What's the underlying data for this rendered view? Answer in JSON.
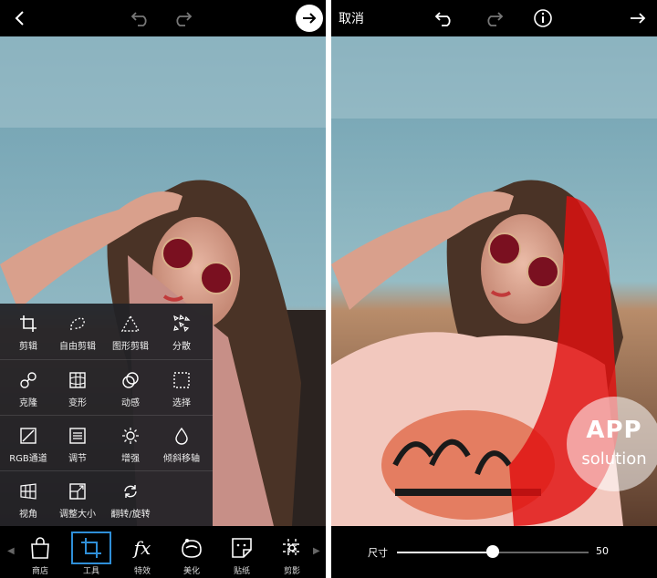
{
  "left": {
    "tools": [
      [
        {
          "label": "剪辑",
          "icon": "crop-icon"
        },
        {
          "label": "自由剪辑",
          "icon": "freecrop-icon"
        },
        {
          "label": "图形剪辑",
          "icon": "shapecrop-icon"
        },
        {
          "label": "分散",
          "icon": "disperse-icon"
        }
      ],
      [
        {
          "label": "克隆",
          "icon": "clone-icon"
        },
        {
          "label": "变形",
          "icon": "warp-icon"
        },
        {
          "label": "动感",
          "icon": "motion-icon"
        },
        {
          "label": "选择",
          "icon": "select-icon"
        }
      ],
      [
        {
          "label": "RGB通道",
          "icon": "rgb-icon"
        },
        {
          "label": "调节",
          "icon": "adjust-icon"
        },
        {
          "label": "增强",
          "icon": "enhance-icon"
        },
        {
          "label": "倾斜移轴",
          "icon": "tiltshift-icon"
        }
      ],
      [
        {
          "label": "视角",
          "icon": "perspective-icon"
        },
        {
          "label": "调整大小",
          "icon": "resize-icon"
        },
        {
          "label": "翻转/旋转",
          "icon": "rotate-icon"
        }
      ]
    ],
    "nav": [
      {
        "label": "商店",
        "icon": "shop-bag-icon"
      },
      {
        "label": "工具",
        "icon": "crop-tool-icon"
      },
      {
        "label": "特效",
        "icon": "fx-icon"
      },
      {
        "label": "美化",
        "icon": "beautify-icon"
      },
      {
        "label": "贴纸",
        "icon": "sticker-icon"
      },
      {
        "label": "剪影",
        "icon": "cutout-icon"
      }
    ]
  },
  "right": {
    "cancel": "取消",
    "slider": {
      "label": "尺寸",
      "value": "50",
      "fraction": 0.5
    },
    "watermark": {
      "line1": "APP",
      "line2": "solution"
    }
  },
  "colors": {
    "accent": "#2f8fd8",
    "mask": "#e01010"
  }
}
